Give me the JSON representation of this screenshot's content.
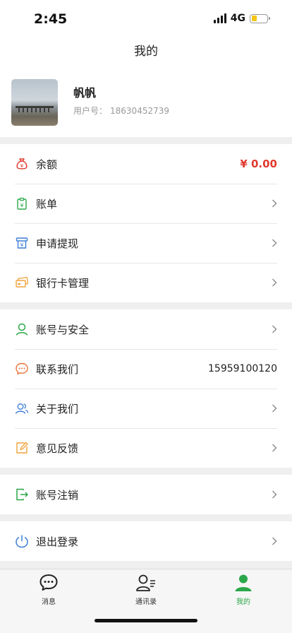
{
  "status": {
    "time": "2:45",
    "network": "4G",
    "battery_level": 0.35
  },
  "nav": {
    "title": "我的"
  },
  "profile": {
    "name": "帆帆",
    "uid_label": "用户号：",
    "uid": "18630452739"
  },
  "wallet": {
    "balance_label": "余额",
    "balance_value": "¥ 0.00",
    "bill_label": "账单",
    "withdraw_label": "申请提现",
    "bankcard_label": "银行卡管理"
  },
  "settings": {
    "security_label": "账号与安全",
    "contact_label": "联系我们",
    "contact_value": "15959100120",
    "about_label": "关于我们",
    "feedback_label": "意见反馈"
  },
  "account": {
    "cancel_label": "账号注销",
    "logout_label": "退出登录"
  },
  "tabbar": {
    "messages": "消息",
    "contacts": "通讯录",
    "mine": "我的"
  },
  "colors": {
    "accent_green": "#2aa84a",
    "money_red": "#e03a2f"
  }
}
